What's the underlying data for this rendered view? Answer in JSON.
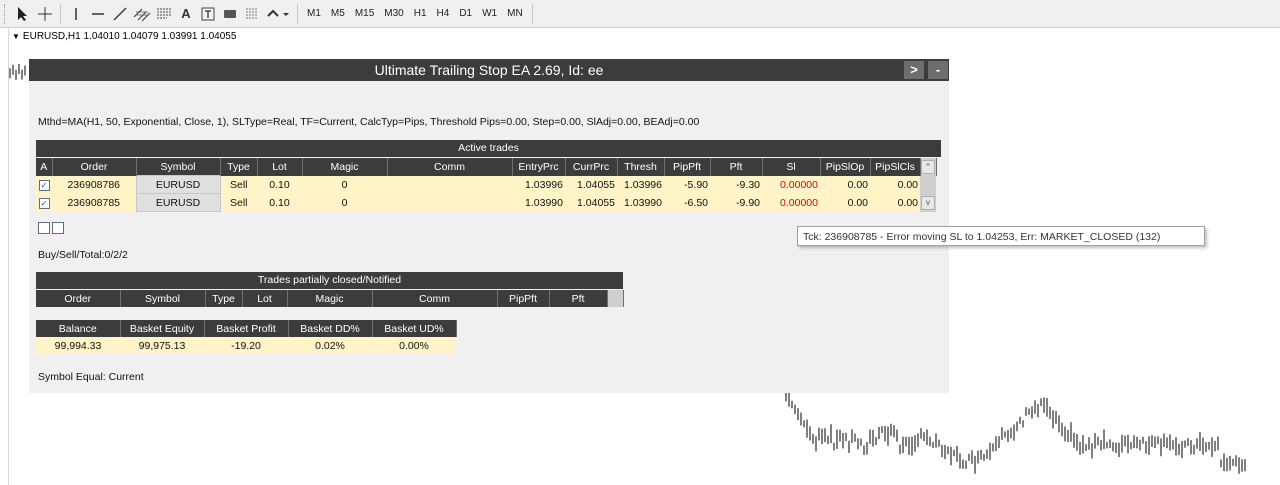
{
  "toolbar": {
    "timeframes": [
      "M1",
      "M5",
      "M15",
      "M30",
      "H1",
      "H4",
      "D1",
      "W1",
      "MN"
    ],
    "text_tool": "A"
  },
  "chart": {
    "symbol_line": "EURUSD,H1  1.04010 1.04079 1.03991 1.04055"
  },
  "panel": {
    "title": "Ultimate Trailing Stop EA 2.69, Id: ee",
    "expand_label": ">",
    "minimize_label": "-",
    "method_line": "Mthd=MA(H1, 50, Exponential, Close, 1), SLType=Real, TF=Current, CalcTyp=Pips, Threshold Pips=0.00, Step=0.00, SlAdj=0.00, BEAdj=0.00",
    "active_trades": {
      "title": "Active trades",
      "columns": [
        "A",
        "Order",
        "Symbol",
        "Type",
        "Lot",
        "Magic",
        "Comm",
        "EntryPrc",
        "CurrPrc",
        "Thresh",
        "PipPft",
        "Pft",
        "Sl",
        "PipSlOp",
        "PipSlCls"
      ],
      "rows": [
        {
          "checked": "✓",
          "order": "236908786",
          "symbol": "EURUSD",
          "type": "Sell",
          "lot": "0.10",
          "magic": "0",
          "comm": "",
          "entry": "1.03996",
          "curr": "1.04055",
          "thresh": "1.03996",
          "pippft": "-5.90",
          "pft": "-9.30",
          "sl": "0.00000",
          "pipslop": "0.00",
          "pipslcls": "0.00"
        },
        {
          "checked": "✓",
          "order": "236908785",
          "symbol": "EURUSD",
          "type": "Sell",
          "lot": "0.10",
          "magic": "0",
          "comm": "",
          "entry": "1.03990",
          "curr": "1.04055",
          "thresh": "1.03990",
          "pippft": "-6.50",
          "pft": "-9.90",
          "sl": "0.00000",
          "pipslop": "0.00",
          "pipslcls": "0.00"
        }
      ],
      "scroll_up": "^",
      "scroll_down": "v"
    },
    "buy_sell_total": "Buy/Sell/Total:0/2/2",
    "partial": {
      "title": "Trades partially closed/Notified",
      "columns": [
        "Order",
        "Symbol",
        "Type",
        "Lot",
        "Magic",
        "Comm",
        "PipPft",
        "Pft"
      ]
    },
    "basket": {
      "columns": [
        "Balance",
        "Basket Equity",
        "Basket Profit",
        "Basket DD%",
        "Basket UD%"
      ],
      "values": [
        "99,994.33",
        "99,975.13",
        "-19.20",
        "0.02%",
        "0.00%"
      ]
    },
    "symbol_equal": "Symbol Equal: Current"
  },
  "tooltip": "Tck: 236908785 - Error moving SL to 1.04253, Err: MARKET_CLOSED (132)",
  "colors": {
    "header_bg": "#3c3c3c",
    "row_bg": "#fff4c8",
    "negative": "#e00000"
  }
}
